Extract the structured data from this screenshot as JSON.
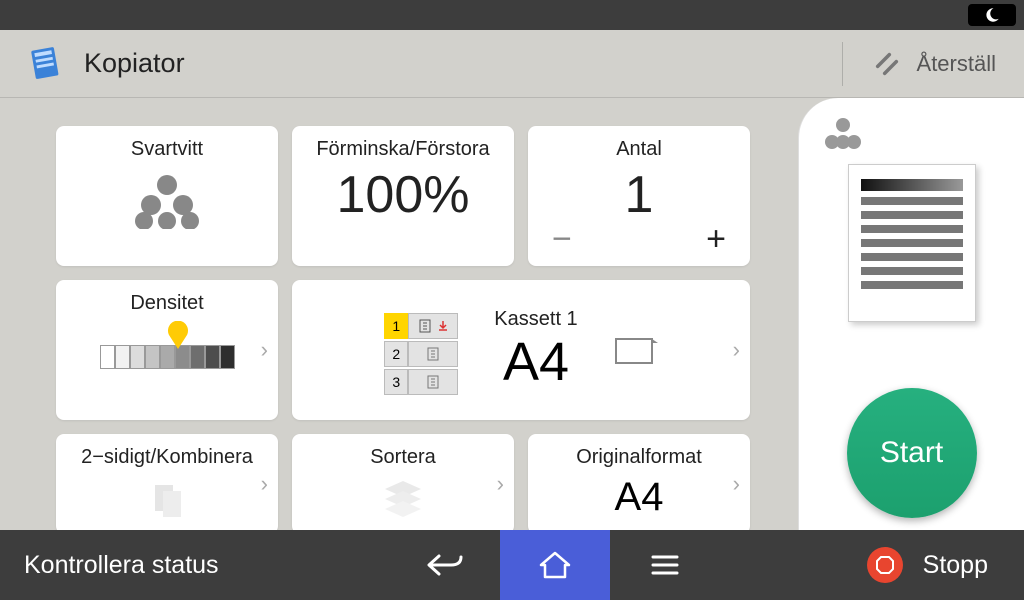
{
  "header": {
    "title": "Kopiator",
    "reset_label": "Återställ"
  },
  "tiles": {
    "bw": {
      "label": "Svartvitt"
    },
    "scale": {
      "label": "Förminska/Förstora",
      "value": "100%"
    },
    "count": {
      "label": "Antal",
      "value": "1"
    },
    "density": {
      "label": "Densitet"
    },
    "tray": {
      "label": "Kassett 1",
      "size": "A4",
      "slots": [
        "1",
        "2",
        "3"
      ]
    },
    "duplex": {
      "label": "2−sidigt/Kombinera"
    },
    "sort": {
      "label": "Sortera"
    },
    "original": {
      "label": "Originalformat",
      "value": "A4"
    }
  },
  "side": {
    "start_label": "Start"
  },
  "bottom": {
    "status_label": "Kontrollera status",
    "stop_label": "Stopp"
  }
}
